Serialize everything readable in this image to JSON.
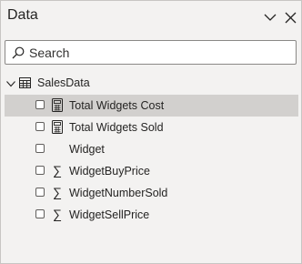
{
  "pane": {
    "title": "Data",
    "collapse_icon": "chevron-down-icon",
    "close_icon": "close-icon"
  },
  "search": {
    "placeholder": "Search",
    "value": ""
  },
  "table": {
    "label": "SalesData",
    "expanded": true,
    "fields": [
      {
        "label": "Total Widgets Cost",
        "icon": "calculator-icon",
        "selected": true
      },
      {
        "label": "Total Widgets Sold",
        "icon": "calculator-icon",
        "selected": false
      },
      {
        "label": "Widget",
        "icon": "",
        "selected": false
      },
      {
        "label": "WidgetBuyPrice",
        "icon": "sigma-icon",
        "selected": false
      },
      {
        "label": "WidgetNumberSold",
        "icon": "sigma-icon",
        "selected": false
      },
      {
        "label": "WidgetSellPrice",
        "icon": "sigma-icon",
        "selected": false
      }
    ]
  },
  "colors": {
    "pane_bg": "#f3f2f1",
    "selected_row": "#d2d0ce",
    "border": "#c8c6c4"
  }
}
